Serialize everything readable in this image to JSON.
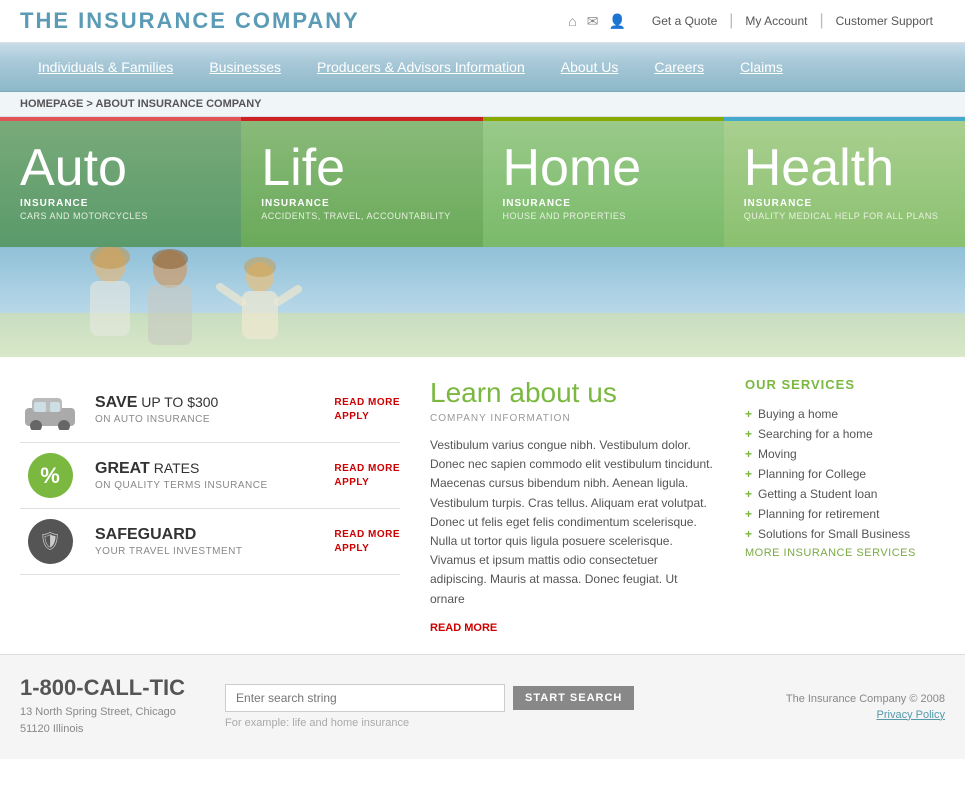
{
  "logo": {
    "text": "THE INSURANCE COMPANY"
  },
  "top_icons": [
    "home-icon",
    "mail-icon",
    "people-icon"
  ],
  "top_links": [
    {
      "label": "Get a Quote",
      "url": "#"
    },
    {
      "label": "My Account",
      "url": "#"
    },
    {
      "label": "Customer Support",
      "url": "#"
    }
  ],
  "nav": {
    "items": [
      {
        "label": "Individuals & Families",
        "url": "#"
      },
      {
        "label": "Businesses",
        "url": "#"
      },
      {
        "label": "Producers & Advisors Information",
        "url": "#"
      },
      {
        "label": "About Us",
        "url": "#"
      },
      {
        "label": "Careers",
        "url": "#"
      },
      {
        "label": "Claims",
        "url": "#"
      }
    ]
  },
  "breadcrumb": {
    "home": "HOMEPAGE",
    "separator": " > ",
    "current": "ABOUT INSURANCE COMPANY"
  },
  "hero": {
    "tabs": [
      {
        "title": "Auto",
        "subtitle": "INSURANCE",
        "desc": "CARS AND MOTORCYCLES"
      },
      {
        "title": "Life",
        "subtitle": "INSURANCE",
        "desc": "ACCIDENTS, TRAVEL, ACCOUNTABILITY"
      },
      {
        "title": "Home",
        "subtitle": "INSURANCE",
        "desc": "HOUSE AND PROPERTIES"
      },
      {
        "title": "Health",
        "subtitle": "INSURANCE",
        "desc": "QUALITY MEDICAL HELP FOR ALL PLANS"
      }
    ]
  },
  "promos": [
    {
      "icon_type": "car",
      "title_bold": "SAVE",
      "title_rest": " UP TO $300",
      "subtitle": "ON AUTO INSURANCE",
      "read_more": "READ MORE",
      "apply": "APPLY"
    },
    {
      "icon_type": "percent",
      "title_bold": "GREAT",
      "title_rest": " RATES",
      "subtitle": "ON QUALITY TERMS INSURANCE",
      "read_more": "READ MORE",
      "apply": "APPLY"
    },
    {
      "icon_type": "shield",
      "title_bold": "SAFEGUARD",
      "title_rest": "",
      "subtitle": "YOUR TRAVEL INVESTMENT",
      "read_more": "READ MORE",
      "apply": "APPLY"
    }
  ],
  "learn": {
    "title": "Learn about us",
    "subtitle": "COMPANY INFORMATION",
    "body": "Vestibulum varius congue nibh. Vestibulum dolor. Donec nec sapien commodo elit vestibulum tincidunt. Maecenas cursus bibendum nibh. Aenean ligula. Vestibulum turpis. Cras tellus. Aliquam erat volutpat. Donec ut felis eget felis condimentum scelerisque. Nulla ut tortor quis ligula posuere scelerisque. Vivamus et ipsum mattis odio consectetuer adipiscing. Mauris at massa. Donec feugiat. Ut ornare",
    "read_more": "READ MORE"
  },
  "services": {
    "title": "OUR SERVICES",
    "items": [
      "Buying a home",
      "Searching for a home",
      "Moving",
      "Planning for College",
      "Getting a Student loan",
      "Planning for retirement",
      "Solutions for Small Business"
    ],
    "more_label": "MORE INSURANCE SERVICES"
  },
  "footer": {
    "phone": "1-800-CALL-TIC",
    "address_line1": "13 North Spring Street, Chicago",
    "address_line2": "51120 Illinois",
    "search_placeholder": "Enter search string",
    "search_hint": "For example: life and home insurance",
    "search_btn": "START SEARCH",
    "copyright": "The Insurance Company © 2008",
    "privacy": "Privacy Policy"
  }
}
